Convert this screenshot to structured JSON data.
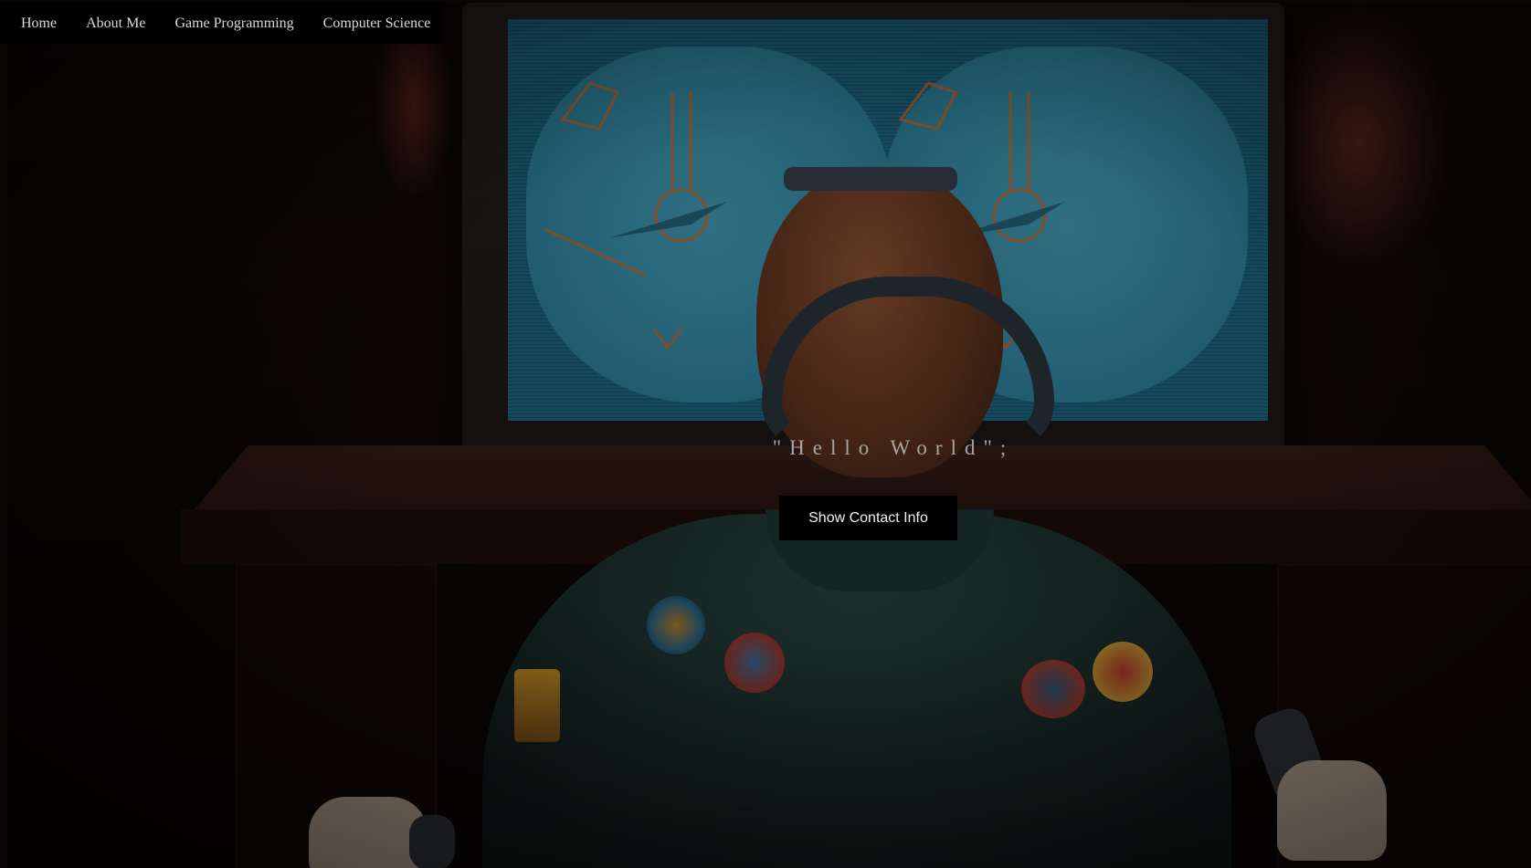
{
  "nav": {
    "items": [
      {
        "label": "Home"
      },
      {
        "label": "About Me"
      },
      {
        "label": "Game Programming"
      },
      {
        "label": "Computer Science"
      }
    ]
  },
  "hero": {
    "heading": "\"Hello World\";",
    "button_label": "Show Contact Info",
    "background_image": "retro-vr-gamer-illustration"
  },
  "colors": {
    "nav_bg": "#000000",
    "nav_text": "#d9d9d9",
    "heading_text": "#a5a5a5",
    "button_bg": "#000000",
    "button_text": "#f0f0f0",
    "screen_blue": "#3b9ab8"
  }
}
